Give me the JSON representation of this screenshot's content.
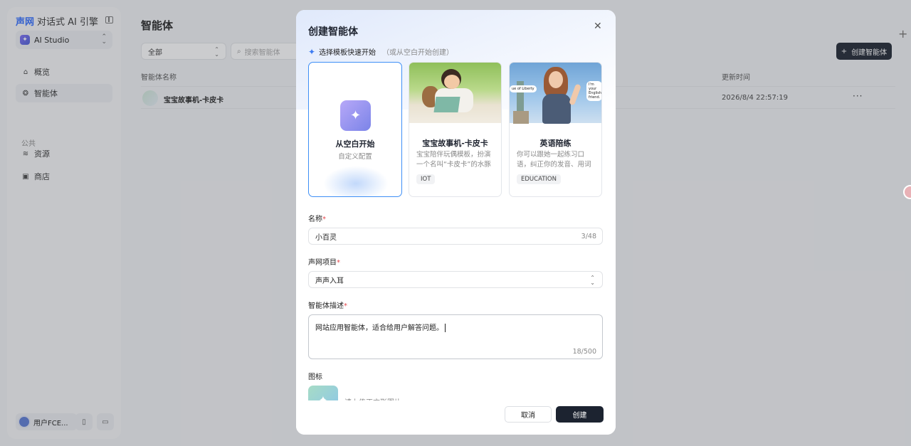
{
  "sidebar": {
    "brand_logo": "声网",
    "brand_title": "对话式 AI 引擎",
    "workspace": "AI Studio",
    "nav": [
      {
        "label": "概览",
        "icon": "home-icon"
      },
      {
        "label": "智能体",
        "icon": "agent-icon"
      }
    ],
    "section_public": "公共",
    "public_nav": [
      {
        "label": "资源",
        "icon": "layers-icon"
      },
      {
        "label": "商店",
        "icon": "store-icon"
      }
    ],
    "user_name": "用户FCE..."
  },
  "main": {
    "title": "智能体",
    "filter_value": "全部",
    "search_placeholder": "搜索智能体",
    "create_label": "创建智能体",
    "columns": {
      "name": "智能体名称",
      "updated": "更新时间"
    },
    "rows": [
      {
        "name": "宝宝故事机-卡皮卡",
        "updated": "2026/8/4 22:57:19",
        "more": "···"
      }
    ]
  },
  "modal": {
    "title": "创建智能体",
    "template_heading": "选择模板快速开始",
    "template_sub": "（或从空白开始创建）",
    "templates": [
      {
        "name": "从空白开始",
        "sub": "自定义配置"
      },
      {
        "name": "宝宝故事机-卡皮卡",
        "desc": "宝宝陪伴玩偶模板，扮演一个名叫“卡皮卡”的水豚",
        "tag": "IOT"
      },
      {
        "name": "英语陪练",
        "desc": "你可以跟她一起练习口语，纠正你的发音、用词",
        "tag": "EDUCATION",
        "bubble_left": "ue of Liberty",
        "bubble_right": "I'm your English friend."
      }
    ],
    "name_label": "名称",
    "name_value": "小百灵",
    "name_count": "3/48",
    "project_label": "声网项目",
    "project_value": "声声入耳",
    "desc_label": "智能体描述",
    "desc_value": "网站应用智能体，适合给用户解答问题。",
    "desc_count": "18/500",
    "icon_label": "图标",
    "icon_hint": "请上传正方形图片",
    "cancel": "取消",
    "create": "创建"
  },
  "colors": {
    "accent": "#3e8ff6",
    "primary_button": "#1c2330",
    "required": "#e5484d"
  }
}
